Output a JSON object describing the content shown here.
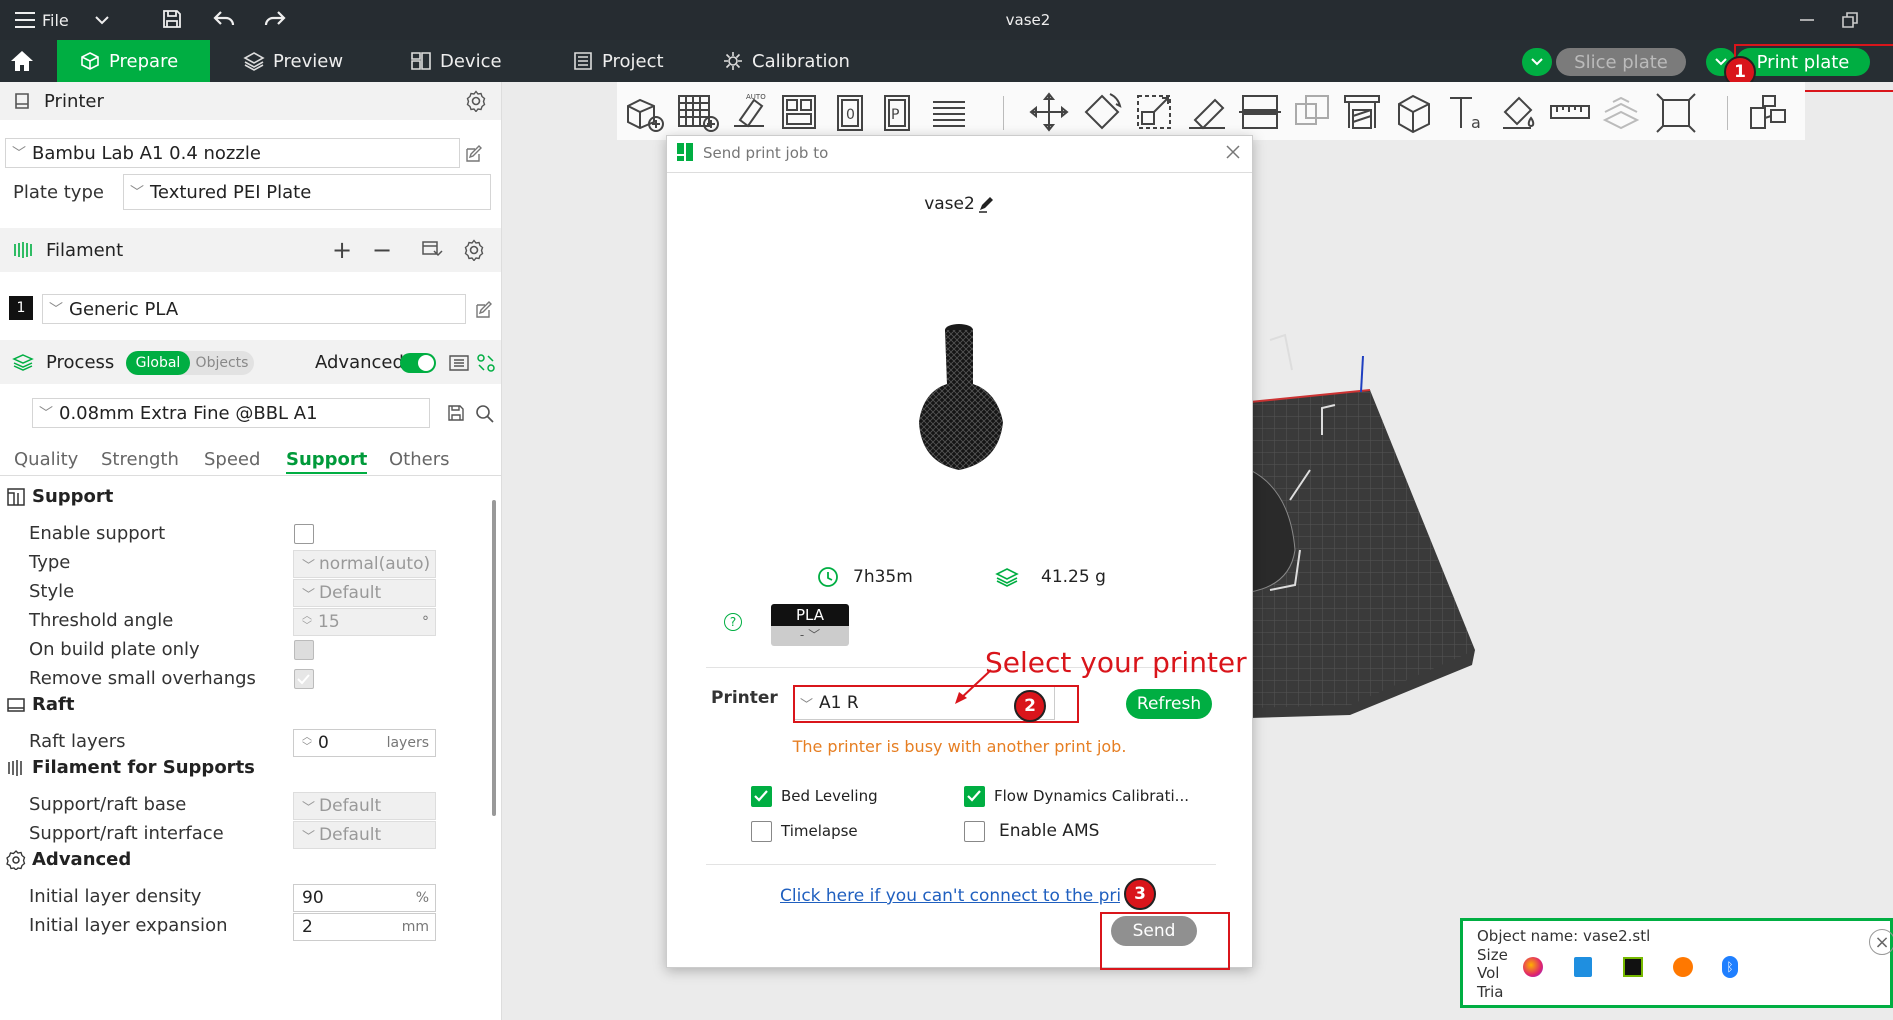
{
  "titlebar": {
    "menu_label": "File",
    "window_title": "vase2"
  },
  "tabs": [
    {
      "label": "Prepare",
      "icon": "cube-icon"
    },
    {
      "label": "Preview",
      "icon": "layers-icon"
    },
    {
      "label": "Device",
      "icon": "device-icon"
    },
    {
      "label": "Project",
      "icon": "project-icon"
    },
    {
      "label": "Calibration",
      "icon": "calibration-icon"
    }
  ],
  "actions": {
    "slice_label": "Slice plate",
    "print_label": "Print plate"
  },
  "sidebar": {
    "printer": {
      "title": "Printer",
      "preset": "Bambu Lab A1 0.4 nozzle",
      "plate_type_label": "Plate type",
      "plate_type": "Textured PEI Plate"
    },
    "filament": {
      "title": "Filament",
      "slot_number": "1",
      "preset": "Generic PLA"
    },
    "process": {
      "title": "Process",
      "toggle_global": "Global",
      "toggle_objects": "Objects",
      "advanced_label": "Advanced",
      "preset": "0.08mm Extra Fine @BBL A1"
    },
    "subtabs": [
      "Quality",
      "Strength",
      "Speed",
      "Support",
      "Others"
    ],
    "active_subtab": "Support",
    "support": {
      "title": "Support",
      "enable_support": "Enable support",
      "type_label": "Type",
      "type_value": "normal(auto)",
      "style_label": "Style",
      "style_value": "Default",
      "threshold_label": "Threshold angle",
      "threshold_value": "15",
      "threshold_unit": "°",
      "build_plate_only": "On build plate only",
      "remove_small": "Remove small overhangs"
    },
    "raft": {
      "title": "Raft",
      "layers_label": "Raft layers",
      "layers_value": "0",
      "layers_unit": "layers"
    },
    "filament_supports": {
      "title": "Filament for Supports",
      "base_label": "Support/raft base",
      "base_value": "Default",
      "interface_label": "Support/raft interface",
      "interface_value": "Default"
    },
    "advanced": {
      "title": "Advanced",
      "density_label": "Initial layer density",
      "density_value": "90",
      "density_unit": "%",
      "expansion_label": "Initial layer expansion",
      "expansion_value": "2",
      "expansion_unit": "mm"
    }
  },
  "dialog": {
    "title": "Send print job to",
    "job_name": "vase2",
    "time": "7h35m",
    "weight": "41.25 g",
    "filament_type": "PLA",
    "filament_slot": "-",
    "annotation": "Select your printer",
    "printer_label": "Printer",
    "printer_value": "A1 R",
    "refresh_label": "Refresh",
    "warning": "The printer is busy with another print job.",
    "options": [
      {
        "label": "Bed Leveling",
        "checked": true
      },
      {
        "label": "Flow Dynamics Calibrati...",
        "checked": true
      },
      {
        "label": "Timelapse",
        "checked": false
      },
      {
        "label": "Enable AMS",
        "checked": false
      }
    ],
    "help_link": "Click here if you can't connect to the printer",
    "send_label": "Send"
  },
  "badges": [
    "1",
    "2",
    "3"
  ],
  "info_panel": {
    "object_name": "Object name: vase2.stl",
    "size": "Size",
    "volume": "Vol",
    "triangles": "Tria"
  },
  "colors": {
    "accent": "#00ae42",
    "annotation_red": "#d9151b",
    "warning_orange": "#e67e22",
    "dark_bar": "#262c31"
  }
}
